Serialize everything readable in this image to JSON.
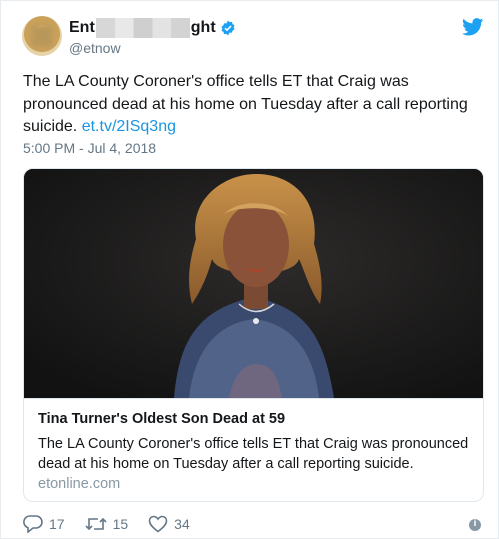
{
  "author": {
    "name_start": "Ent",
    "name_end": "ght",
    "handle": "@etnow"
  },
  "tweet": {
    "text": "The LA County Coroner's office tells ET that Craig was pronounced dead at his home on Tuesday after a call reporting suicide. ",
    "link": "et.tv/2ISq3ng",
    "timestamp": "5:00 PM - Jul 4, 2018"
  },
  "card": {
    "title": "Tina Turner's Oldest Son Dead at 59",
    "description": "The LA County Coroner's office tells ET that Craig was pronounced dead at his home on Tuesday after a call reporting suicide.",
    "domain": "etonline.com"
  },
  "actions": {
    "replies": "17",
    "retweets": "15",
    "likes": "34"
  },
  "icons": {
    "verified": "verified-badge-icon",
    "bird": "twitter-bird-icon",
    "reply": "reply-icon",
    "retweet": "retweet-icon",
    "like": "heart-icon",
    "info": "info-icon"
  },
  "colors": {
    "accent": "#1da1f2",
    "link": "#1b95e0",
    "muted": "#657786"
  }
}
